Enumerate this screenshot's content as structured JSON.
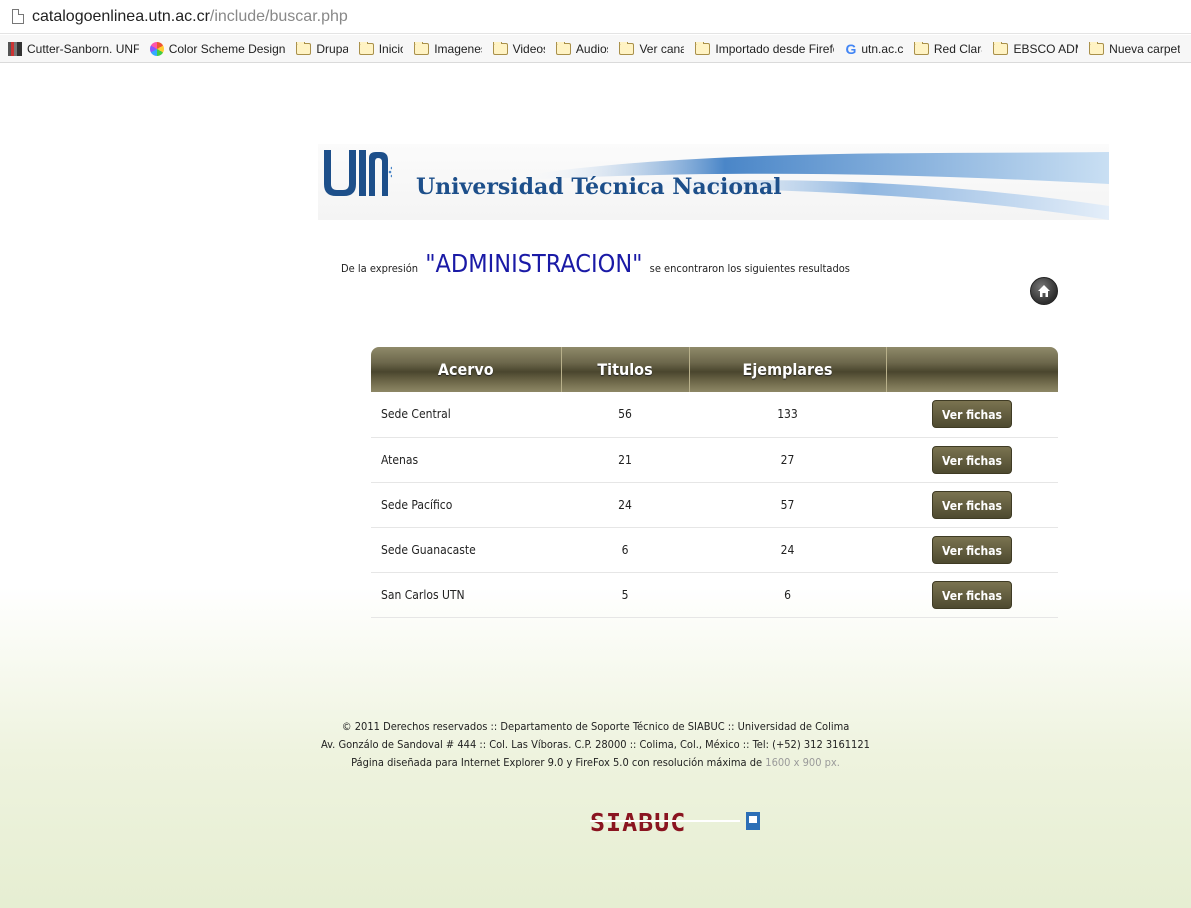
{
  "browser": {
    "url_host": "catalogoenlinea.utn.ac.cr",
    "url_path": "/include/buscar.php",
    "bookmarks": [
      {
        "label": "Cutter-Sanborn. UNFC",
        "icon": "book-icon"
      },
      {
        "label": "Color Scheme Designer",
        "icon": "color-wheel-icon"
      },
      {
        "label": "Drupal",
        "icon": "folder-icon"
      },
      {
        "label": "Inicio",
        "icon": "folder-icon"
      },
      {
        "label": "Imagenes",
        "icon": "folder-icon"
      },
      {
        "label": "Videos",
        "icon": "folder-icon"
      },
      {
        "label": "Audios",
        "icon": "folder-icon"
      },
      {
        "label": "Ver canal",
        "icon": "folder-icon"
      },
      {
        "label": "Importado desde Firefox",
        "icon": "folder-icon"
      },
      {
        "label": "utn.ac.cr",
        "icon": "google-icon"
      },
      {
        "label": "Red Clara",
        "icon": "folder-icon"
      },
      {
        "label": "EBSCO ADM",
        "icon": "folder-icon"
      },
      {
        "label": "Nueva carpeta",
        "icon": "folder-icon"
      }
    ]
  },
  "header": {
    "university_name": "Universidad Técnica Nacional",
    "logo_text": "UTN"
  },
  "search": {
    "prefix": "De la expresión",
    "term": "\"ADMINISTRACION\"",
    "suffix": "se encontraron los siguientes resultados"
  },
  "table": {
    "headers": [
      "Acervo",
      "Titulos",
      "Ejemplares",
      ""
    ],
    "button_label": "Ver fichas",
    "rows": [
      {
        "acervo": "Sede Central",
        "titulos": "56",
        "ejemplares": "133"
      },
      {
        "acervo": "Atenas",
        "titulos": "21",
        "ejemplares": "27"
      },
      {
        "acervo": "Sede Pacífico",
        "titulos": "24",
        "ejemplares": "57"
      },
      {
        "acervo": "Sede Guanacaste",
        "titulos": "6",
        "ejemplares": "24"
      },
      {
        "acervo": "San Carlos UTN",
        "titulos": "5",
        "ejemplares": "6"
      }
    ]
  },
  "footer": {
    "line1": "© 2011 Derechos reservados :: Departamento de Soporte Técnico de SIABUC :: Universidad de Colima",
    "line2": "Av. Gonzálo de Sandoval # 444 :: Col. Las Víboras. C.P. 28000 :: Colima, Col., México :: Tel: (+52) 312 3161121",
    "line3_prefix": "Página diseñada para Internet Explorer 9.0 y FireFox 5.0 con resolución máxima de",
    "line3_resolution": "1600 x 900 px.",
    "logo_text": "SIABUC"
  },
  "colors": {
    "header_olive": "#5a5538",
    "term_blue": "#1a1aa6",
    "university_blue": "#1d4f8a",
    "siabuc_red": "#8a1420",
    "siabuc_blue": "#2c6fb6"
  }
}
